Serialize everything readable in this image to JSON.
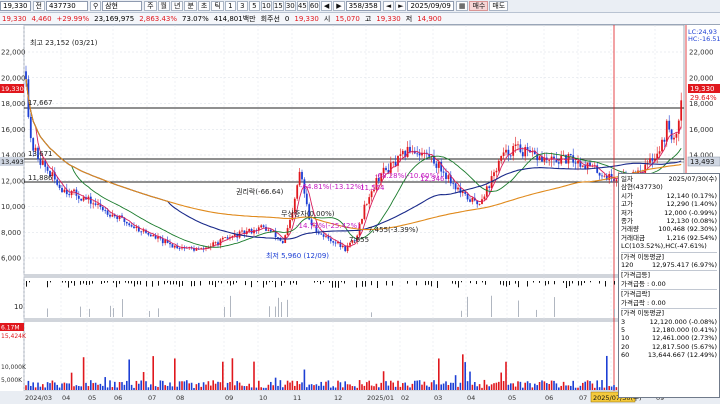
{
  "toolbar": {
    "account": "19,330",
    "period_btn": "전",
    "code": "437730",
    "name": "삼현",
    "volume": "23,169,975",
    "volume_ratio": "2,863.43%",
    "turnover": "73.07%",
    "amount": "414,801백만",
    "mode": "회주선",
    "zero": "0",
    "p_label": "19,330",
    "change": "4,460",
    "change_pct": "+29.99%",
    "periods": [
      "주",
      "월",
      "년",
      "분",
      "초",
      "틱"
    ],
    "minutes": [
      "1",
      "3",
      "5",
      "10",
      "15",
      "30",
      "45",
      "60"
    ],
    "counter": "358/358",
    "open_label": "시",
    "open": "15,070",
    "high_label": "고",
    "high": "19,330",
    "low_label": "저",
    "low": "14,900",
    "date": "2025/09/09",
    "buy": "매수",
    "sell": "매도"
  },
  "chart_labels": {
    "price_high": "최고 23,152 (03/21)",
    "price_low": "최저 5,960 (12/09)",
    "h1": "17,667",
    "h2": "13,671",
    "h3": "11,886",
    "rights": "권리락(-66.64)",
    "rights2": "무상증자(0.00%)",
    "ann1": "-64.81%(-13.12%)",
    "ann2": "-14.71%(-25.42%)",
    "ann3": "-68.28%(-10.60%)",
    "ann4": "11,554",
    "ann5": "12,346",
    "ann6": "7,655",
    "ann7": "7,455(-3.39%)",
    "right_price1": "19,330",
    "right_price2": "29.64%",
    "right_price3": "13,493",
    "left_price": "13,493",
    "lc_label": "LC:24,93",
    "hc_label": "HC:-16.51",
    "left_vol": "6.17M",
    "left_vol2": "15,424K"
  },
  "y_axis": [
    "22,000",
    "20,000",
    "18,000",
    "16,000",
    "14,000",
    "12,000",
    "10,000",
    "8,000",
    "6,000"
  ],
  "x_axis": [
    "2024/03",
    "04",
    "05",
    "06",
    "07",
    "08",
    "09",
    "10",
    "11",
    "12",
    "2025/01",
    "02",
    "03",
    "04",
    "05",
    "06",
    "07",
    "08",
    "09"
  ],
  "cursor_date": "2025/07/30(수)",
  "osc_y": [
    "10"
  ],
  "vol_y": [
    "15,000K",
    "10,000K",
    "5,000K"
  ],
  "vol_y_left": [
    "10,000K",
    "5,000K"
  ],
  "info": {
    "title": "일자",
    "date": "2025/07/30(수)",
    "name": "삼현(437730)",
    "rows": [
      {
        "k": "시가",
        "v": "12,140 (0.17%)"
      },
      {
        "k": "고가",
        "v": "12,290 (1.40%)"
      },
      {
        "k": "저가",
        "v": "12,000 (-0.99%)"
      },
      {
        "k": "종가",
        "v": "12,130 (0.08%)"
      },
      {
        "k": "거래량",
        "v": "100,468 (92.30%)"
      },
      {
        "k": "거래대금",
        "v": "1,216 (92.54%)"
      }
    ],
    "lc": "LC(103.52%),HC(-47.61%)",
    "ma_title": "[가격 이동평균]",
    "ma120_k": "120",
    "ma120_v": "12,975.417 (6.97%)",
    "sec1": "[가격급등]",
    "sec1v": "가격급등 : 0.00",
    "sec2": "[가격급락]",
    "sec2v": "가격급락 : 0.00",
    "ma_title2": "[가격 이동평균]",
    "ma": [
      {
        "k": "3",
        "v": "12,120.000 (-0.08%)"
      },
      {
        "k": "5",
        "v": "12,180.000 (0.41%)"
      },
      {
        "k": "10",
        "v": "12,461.000 (2.73%)"
      },
      {
        "k": "20",
        "v": "12,817.500 (5.67%)"
      },
      {
        "k": "60",
        "v": "13,644.667 (12.49%)"
      }
    ]
  },
  "colors": {
    "up": "#e0171d",
    "down": "#1d3fd4",
    "ma_short": "#d91e5b",
    "ma_mid": "#1a7b2c",
    "ma_long": "#1a2a8a",
    "ma_120": "#e08a1c"
  }
}
